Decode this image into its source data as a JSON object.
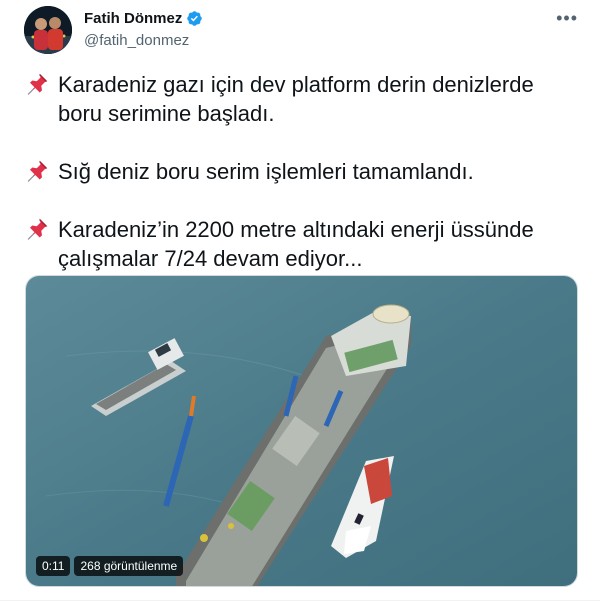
{
  "author": {
    "display_name": "Fatih Dönmez",
    "handle": "@fatih_donmez",
    "verified": true
  },
  "more_icon": "ellipsis-icon",
  "tweet": {
    "paragraphs": [
      {
        "icon": "pushpin-icon",
        "text": "Karadeniz gazı için dev platform derin denizlerde\nboru serimine başladı."
      },
      {
        "icon": "pushpin-icon",
        "text": "Sığ deniz boru serim işlemleri tamamlandı."
      },
      {
        "icon": "pushpin-icon",
        "text": "Karadeniz’in 2200 metre altındaki enerji üssünde\nçalışmalar 7/24 devam ediyor..."
      }
    ]
  },
  "video": {
    "duration": "0:11",
    "views": "268 görüntülenme"
  },
  "colors": {
    "text": "#0f1419",
    "secondary": "#536471",
    "verified": "#1d9bf0",
    "pin_red": "#e0314a",
    "sea": "#4f7f8e"
  }
}
